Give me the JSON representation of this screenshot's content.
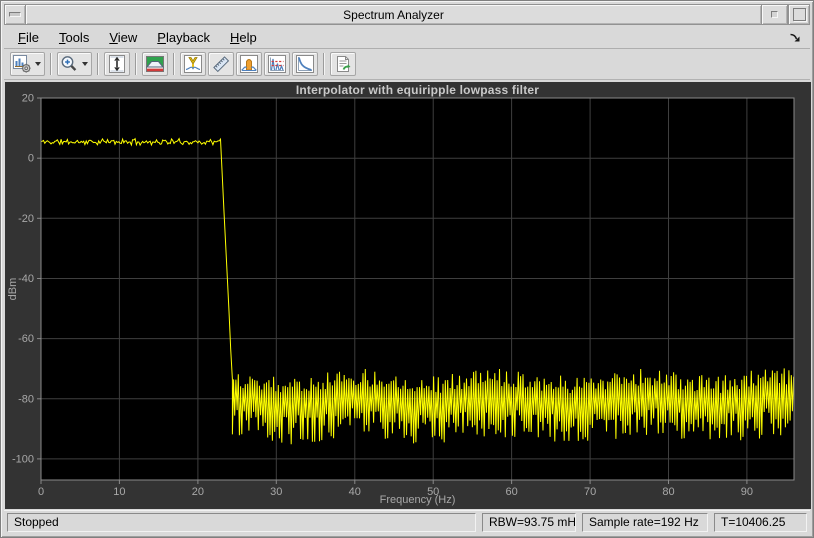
{
  "window": {
    "title": "Spectrum Analyzer"
  },
  "menu_bar": {
    "items": [
      {
        "label": "File",
        "mnemonic": "F"
      },
      {
        "label": "Tools",
        "mnemonic": "T"
      },
      {
        "label": "View",
        "mnemonic": "V"
      },
      {
        "label": "Playback",
        "mnemonic": "P"
      },
      {
        "label": "Help",
        "mnemonic": "H"
      }
    ]
  },
  "toolbar": {
    "groups": [
      [
        {
          "icon": "spectrum-settings-icon",
          "dropdown": true
        }
      ],
      [
        {
          "icon": "zoom-in-icon",
          "dropdown": true
        }
      ],
      [
        {
          "icon": "fit-y-axis-icon"
        }
      ],
      [
        {
          "icon": "spectral-mask-icon"
        }
      ],
      [
        {
          "icon": "peak-finder-icon"
        },
        {
          "icon": "cursor-measurements-icon"
        },
        {
          "icon": "channel-measurements-icon"
        },
        {
          "icon": "distortion-measurements-icon"
        },
        {
          "icon": "ccdf-measurements-icon"
        }
      ],
      [
        {
          "icon": "playback-settings-icon"
        }
      ]
    ]
  },
  "chart_data": {
    "type": "line",
    "title": "Interpolator with equiripple lowpass filter",
    "xlabel": "Frequency (Hz)",
    "ylabel": "dBm",
    "xlim": [
      0,
      96
    ],
    "ylim": [
      -107,
      20
    ],
    "xticks": [
      0,
      10,
      20,
      30,
      40,
      50,
      60,
      70,
      80,
      90
    ],
    "yticks": [
      20,
      0,
      -20,
      -40,
      -60,
      -80,
      -100
    ],
    "grid": true,
    "legend": "none",
    "series": [
      {
        "name": "spectrum-trace",
        "color": "#ffff00",
        "description": "Lowpass interpolated spectrum: flat noisy passband ~+5 dBm from 0 to ~23 Hz, steep transition 23-24.4 Hz, equiripple stopband oscillating between ~-72 and ~-94 dBm out to 96 Hz",
        "key_points": [
          [
            0,
            5.4
          ],
          [
            22.9,
            5.2
          ],
          [
            23.5,
            -20
          ],
          [
            24.4,
            -74
          ],
          [
            40,
            -82
          ],
          [
            60,
            -82
          ],
          [
            80,
            -82
          ],
          [
            96,
            -83
          ]
        ],
        "trace": {
          "seed": 11,
          "passband_level_dbm": 5.4,
          "passband_ripple_db": 1.2,
          "passband_edge_hz": 22.9,
          "stopband_start_hz": 24.4,
          "stopband_top_dbm": -74,
          "stopband_bottom_dbm": -89,
          "passband_step_hz": 0.16,
          "stopband_step_hz": 0.15
        }
      }
    ]
  },
  "status_bar": {
    "state": "Stopped",
    "rbw": "RBW=93.75 mHz",
    "sample_rate": "Sample rate=192 Hz",
    "time": "T=10406.25"
  },
  "colors": {
    "trace": "#ffff00",
    "plot_background": "#000000",
    "panel_background": "#333333",
    "grid": "#3f3f3f",
    "axis": "#8a8a8a",
    "tick_label": "#a8a8a8",
    "plot_title": "#c9c9c9",
    "chrome": "#d9d9d9"
  }
}
